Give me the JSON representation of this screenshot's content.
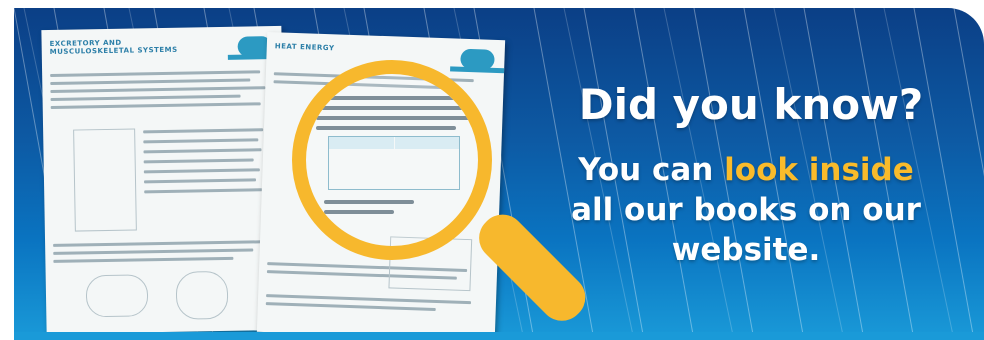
{
  "banner": {
    "headline": "Did you know?",
    "body_line1_pre": "You can ",
    "body_line1_highlight": "look inside",
    "body_line2": "all our books on our",
    "body_line3": "website.",
    "colors": {
      "background_dark": "#0b3f86",
      "background_light": "#1a9ad8",
      "highlight": "#f9bb2b",
      "magnifier": "#f7b82d",
      "text": "#ffffff"
    }
  },
  "pages": {
    "left_title_line1": "EXCRETORY AND",
    "left_title_line2": "MUSCULOSKELETAL SYSTEMS",
    "right_title": "HEAT ENERGY"
  },
  "magnifier": {
    "icon": "magnifying-glass-icon"
  }
}
